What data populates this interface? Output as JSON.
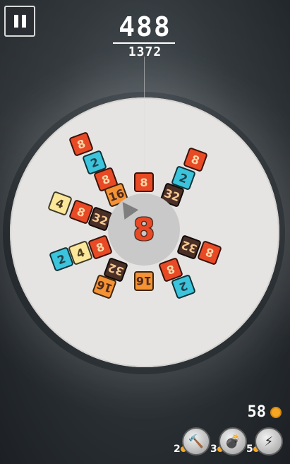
{
  "score": "488",
  "best": "1372",
  "hub_value": "8",
  "coins": "58",
  "colors": {
    "red": "#e84a26",
    "orange": "#f59234",
    "cyan": "#3bc4dc",
    "yellow": "#fbe79a",
    "brown": "#4a2f27"
  },
  "tiles": [
    {
      "v": "8",
      "c": "red"
    },
    {
      "v": "2",
      "c": "cyan"
    },
    {
      "v": "8",
      "c": "red"
    },
    {
      "v": "16",
      "c": "orange"
    },
    {
      "v": "8",
      "c": "red"
    },
    {
      "v": "8",
      "c": "red"
    },
    {
      "v": "2",
      "c": "cyan"
    },
    {
      "v": "32",
      "c": "brown"
    },
    {
      "v": "4",
      "c": "yellow"
    },
    {
      "v": "8",
      "c": "red"
    },
    {
      "v": "32",
      "c": "brown"
    },
    {
      "v": "32",
      "c": "brown"
    },
    {
      "v": "8",
      "c": "red"
    },
    {
      "v": "2",
      "c": "cyan"
    },
    {
      "v": "4",
      "c": "yellow"
    },
    {
      "v": "8",
      "c": "red"
    },
    {
      "v": "32",
      "c": "brown"
    },
    {
      "v": "16",
      "c": "orange"
    },
    {
      "v": "16",
      "c": "orange"
    },
    {
      "v": "8",
      "c": "red"
    },
    {
      "v": "2",
      "c": "cyan"
    }
  ],
  "powerups": [
    {
      "count": "2",
      "icon": "hammer-icon",
      "glyph": "🔨"
    },
    {
      "count": "3",
      "icon": "bomb-icon",
      "glyph": "💣"
    },
    {
      "count": "5",
      "icon": "lightning-icon",
      "glyph": "⚡"
    }
  ]
}
